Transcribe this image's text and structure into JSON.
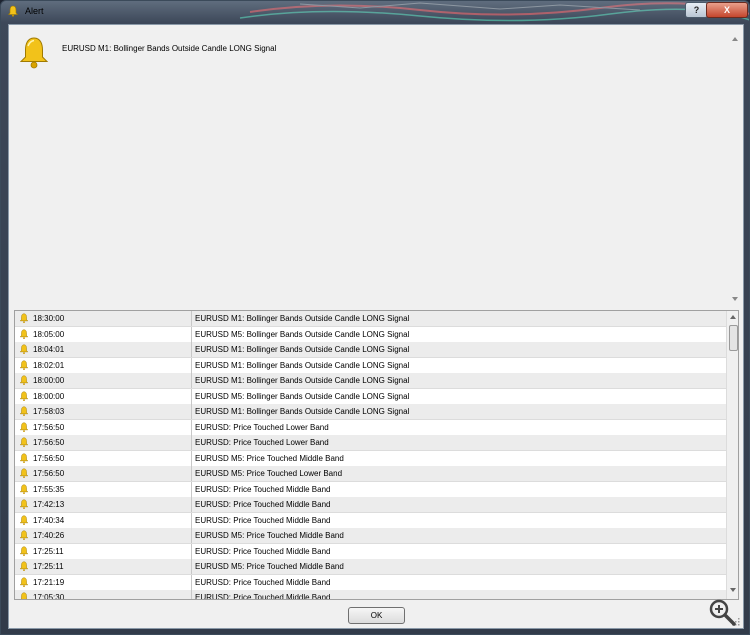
{
  "window": {
    "title": "Alert",
    "help_label": "?",
    "close_label": "X"
  },
  "message": {
    "text": "EURUSD M1: Bollinger Bands Outside Candle LONG Signal",
    "icon": "bell-icon"
  },
  "alerts": [
    {
      "time": "18:30:00",
      "message": "EURUSD M1: Bollinger Bands Outside Candle LONG Signal"
    },
    {
      "time": "18:05:00",
      "message": "EURUSD M5: Bollinger Bands Outside Candle LONG Signal"
    },
    {
      "time": "18:04:01",
      "message": "EURUSD M1: Bollinger Bands Outside Candle LONG Signal"
    },
    {
      "time": "18:02:01",
      "message": "EURUSD M1: Bollinger Bands Outside Candle LONG Signal"
    },
    {
      "time": "18:00:00",
      "message": "EURUSD M1: Bollinger Bands Outside Candle LONG Signal"
    },
    {
      "time": "18:00:00",
      "message": "EURUSD M5: Bollinger Bands Outside Candle LONG Signal"
    },
    {
      "time": "17:58:03",
      "message": "EURUSD M1: Bollinger Bands Outside Candle LONG Signal"
    },
    {
      "time": "17:56:50",
      "message": "EURUSD: Price Touched Lower Band"
    },
    {
      "time": "17:56:50",
      "message": "EURUSD: Price Touched Lower Band"
    },
    {
      "time": "17:56:50",
      "message": "EURUSD M5: Price Touched Middle Band"
    },
    {
      "time": "17:56:50",
      "message": "EURUSD M5: Price Touched Lower Band"
    },
    {
      "time": "17:55:35",
      "message": "EURUSD: Price Touched Middle Band"
    },
    {
      "time": "17:42:13",
      "message": "EURUSD: Price Touched Middle Band"
    },
    {
      "time": "17:40:34",
      "message": "EURUSD: Price Touched Middle Band"
    },
    {
      "time": "17:40:26",
      "message": "EURUSD M5: Price Touched Middle Band"
    },
    {
      "time": "17:25:11",
      "message": "EURUSD: Price Touched Middle Band"
    },
    {
      "time": "17:25:11",
      "message": "EURUSD M5: Price Touched Middle Band"
    },
    {
      "time": "17:21:19",
      "message": "EURUSD: Price Touched Middle Band"
    },
    {
      "time": "17:05:30",
      "message": "EURUSD: Price Touched Middle Band"
    }
  ],
  "buttons": {
    "ok": "OK"
  },
  "colors": {
    "bell": "#f2c21a",
    "window_bg": "#f0f0f0",
    "row_alt": "#ececec"
  }
}
